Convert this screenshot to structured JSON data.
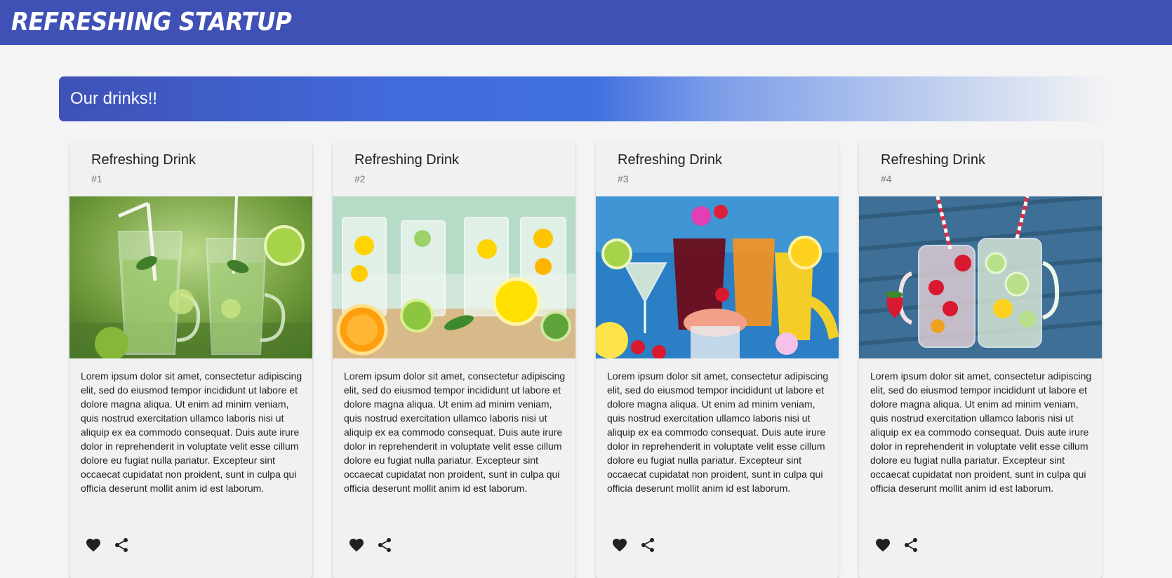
{
  "app": {
    "brand": "REFRESHING STARTUP"
  },
  "banner": {
    "title": "Our drinks!!"
  },
  "cards": [
    {
      "title": "Refreshing Drink",
      "subtitle": "#1",
      "image_icon": "mojito-glasses-image",
      "body": "Lorem ipsum dolor sit amet, consectetur adipiscing elit, sed do eiusmod tempor incididunt ut labore et dolore magna aliqua. Ut enim ad minim veniam, quis nostrud exercitation ullamco laboris nisi ut aliquip ex ea commodo consequat. Duis aute irure dolor in reprehenderit in voluptate velit esse cillum dolore eu fugiat nulla pariatur. Excepteur sint occaecat cupidatat non proident, sunt in culpa qui officia deserunt mollit anim id est laborum.",
      "actions": [
        "favorite-icon",
        "share-icon"
      ]
    },
    {
      "title": "Refreshing Drink",
      "subtitle": "#2",
      "image_icon": "infused-water-glasses-image",
      "body": "Lorem ipsum dolor sit amet, consectetur adipiscing elit, sed do eiusmod tempor incididunt ut labore et dolore magna aliqua. Ut enim ad minim veniam, quis nostrud exercitation ullamco laboris nisi ut aliquip ex ea commodo consequat. Duis aute irure dolor in reprehenderit in voluptate velit esse cillum dolore eu fugiat nulla pariatur. Excepteur sint occaecat cupidatat non proident, sunt in culpa qui officia deserunt mollit anim id est laborum.",
      "actions": [
        "favorite-icon",
        "share-icon"
      ]
    },
    {
      "title": "Refreshing Drink",
      "subtitle": "#3",
      "image_icon": "tropical-cocktails-image",
      "body": "Lorem ipsum dolor sit amet, consectetur adipiscing elit, sed do eiusmod tempor incididunt ut labore et dolore magna aliqua. Ut enim ad minim veniam, quis nostrud exercitation ullamco laboris nisi ut aliquip ex ea commodo consequat. Duis aute irure dolor in reprehenderit in voluptate velit esse cillum dolore eu fugiat nulla pariatur. Excepteur sint occaecat cupidatat non proident, sunt in culpa qui officia deserunt mollit anim id est laborum.",
      "actions": [
        "favorite-icon",
        "share-icon"
      ]
    },
    {
      "title": "Refreshing Drink",
      "subtitle": "#4",
      "image_icon": "mason-jar-drinks-image",
      "body": "Lorem ipsum dolor sit amet, consectetur adipiscing elit, sed do eiusmod tempor incididunt ut labore et dolore magna aliqua. Ut enim ad minim veniam, quis nostrud exercitation ullamco laboris nisi ut aliquip ex ea commodo consequat. Duis aute irure dolor in reprehenderit in voluptate velit esse cillum dolore eu fugiat nulla pariatur. Excepteur sint occaecat cupidatat non proident, sunt in culpa qui officia deserunt mollit anim id est laborum.",
      "actions": [
        "favorite-icon",
        "share-icon"
      ]
    }
  ],
  "colors": {
    "toolbar": "#3f51b5",
    "banner_start": "#3f51b5",
    "banner_mid": "#4170e0",
    "background": "#f4f4f4",
    "card": "#f1f1f1"
  }
}
